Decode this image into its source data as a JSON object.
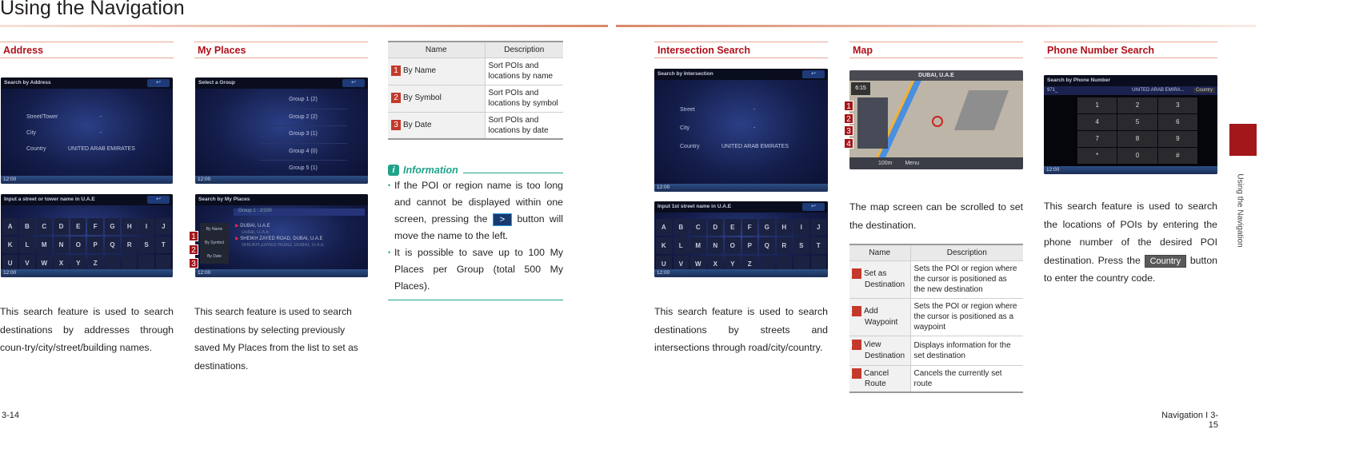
{
  "page_title": "Using the Navigation",
  "side_tab": {
    "label": "Using the Navigation",
    "color": "#a3161a"
  },
  "accent_color": "#b0101c",
  "sections": {
    "address": {
      "heading": "Address",
      "screen1": {
        "title": "Search by Address",
        "fields": [
          [
            "Street/Tower",
            "-"
          ],
          [
            "City",
            "-"
          ],
          [
            "Country",
            "UNITED ARAB EMIRATES"
          ]
        ],
        "clock": "12:00"
      },
      "screen2": {
        "title": "Input a street or tower name in U.A.E",
        "clock": "12:00"
      },
      "text": "This search feature is used to search destinations by addresses through coun-try/city/street/building names."
    },
    "my_places": {
      "heading": "My Places",
      "screen1": {
        "title": "Select a Group",
        "groups": [
          "Group 1 (2)",
          "Group 2 (2)",
          "Group 3 (1)",
          "Group 4 (0)",
          "Group 5 (1)"
        ],
        "clock": "12:00"
      },
      "screen2": {
        "title": "Search by My Places",
        "group_label": "Group 1 : 2/100",
        "sort_buttons": [
          "By Name",
          "By Symbol",
          "By Date"
        ],
        "items": [
          {
            "name": "DUBAI, U.A.E",
            "sub": "Dubai, U.A.E"
          },
          {
            "name": "SHEIKH ZAYED ROAD, DUBAI, U.A.E",
            "sub": "SHEIKH ZAYED ROAD, DUBAI, U.A.E"
          }
        ],
        "clock": "12:00"
      },
      "callouts": [
        "1",
        "2",
        "3"
      ],
      "text": "This search feature is used to search destinations by selecting previously saved My Places from the list to set as destinations."
    },
    "my_places_table": {
      "headers": [
        "Name",
        "Description"
      ],
      "rows": [
        {
          "num": "1",
          "name": "By Name",
          "desc": "Sort POIs and locations by name"
        },
        {
          "num": "2",
          "name": "By Symbol",
          "desc": "Sort POIs and locations by symbol"
        },
        {
          "num": "3",
          "name": "By Date",
          "desc": "Sort POIs and locations by date"
        }
      ]
    },
    "information": {
      "heading": "Information",
      "bullet1_a": "If the POI or region name is too long and cannot be displayed within one screen, pressing the",
      "button_label": ">",
      "bullet1_b": "button will move the name to the left.",
      "bullet2": "It is possible to save up to 100 My Places per Group (total 500 My Places)."
    },
    "intersection": {
      "heading": "Intersection Search",
      "screen1": {
        "title": "Search by Intersection",
        "fields": [
          [
            "Street",
            "-"
          ],
          [
            "City",
            "-"
          ],
          [
            "Country",
            "UNITED ARAB EMIRATES"
          ]
        ],
        "clock": "12:00"
      },
      "screen2": {
        "title": "Input 1st street name in U.A.E",
        "clock": "12:00"
      },
      "text": "This search feature is used to search destinations by streets and intersections through road/city/country."
    },
    "map": {
      "heading": "Map",
      "screen": {
        "location": "DUBAI, U.A.E",
        "time": "6:15",
        "menu": "Menu",
        "scale": "100m"
      },
      "callouts": [
        "1",
        "2",
        "3",
        "4"
      ],
      "text": "The map screen can be scrolled to set the destination.",
      "table": {
        "headers": [
          "Name",
          "Description"
        ],
        "rows": [
          {
            "num": "1",
            "name": "Set as Destination",
            "desc": "Sets the POI or region where the cursor is positioned as the new destination"
          },
          {
            "num": "2",
            "name": "Add Waypoint",
            "desc": "Sets the POI or region where the cursor is positioned as a waypoint"
          },
          {
            "num": "3",
            "name": "View Destination",
            "desc": "Displays information for the set destination"
          },
          {
            "num": "4",
            "name": "Cancel Route",
            "desc": "Cancels the currently set route"
          }
        ]
      }
    },
    "phone": {
      "heading": "Phone Number Search",
      "screen": {
        "title": "Search by Phone Number",
        "input": "971_",
        "country": "UNITED ARAB EMIRA...",
        "country_btn": "Country",
        "keys": [
          "1",
          "2",
          "3",
          "4",
          "5",
          "6",
          "7",
          "8",
          "9",
          "*",
          "0",
          "#"
        ],
        "clock": "12:00"
      },
      "text_a": "This search feature is used to search the locations of POIs by entering the phone number of the desired POI destination. Press the",
      "button_label": "Country",
      "text_b": "button to enter the country code."
    }
  },
  "keyboard": [
    "A",
    "B",
    "C",
    "D",
    "E",
    "F",
    "G",
    "H",
    "I",
    "J",
    "K",
    "L",
    "M",
    "N",
    "O",
    "P",
    "Q",
    "R",
    "S",
    "T",
    "U",
    "V",
    "W",
    "X",
    "Y",
    "Z",
    "",
    "",
    "",
    ""
  ],
  "footer": {
    "left": "3-14",
    "right": "Navigation I 3-15"
  }
}
